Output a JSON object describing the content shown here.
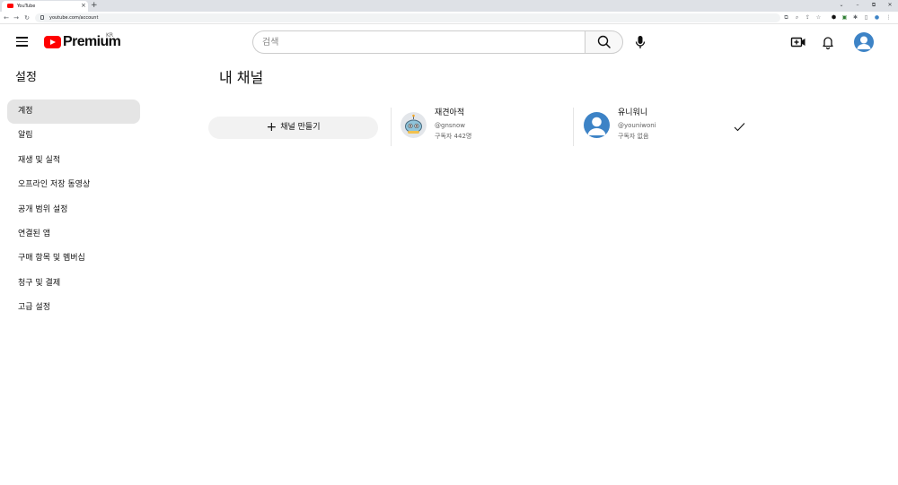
{
  "browser": {
    "tab_title": "YouTube",
    "tab_close": "×",
    "new_tab": "+",
    "url": "youtube.com/account",
    "win_min": "–",
    "win_restore": "⧉",
    "win_close": "✕",
    "win_dropdown": "⌄"
  },
  "header": {
    "logo_text": "Premium",
    "region": "KR",
    "search_placeholder": "검색"
  },
  "sidebar": {
    "title": "설정",
    "items": [
      {
        "label": "계정",
        "active": true
      },
      {
        "label": "알림"
      },
      {
        "label": "재생 및 실적"
      },
      {
        "label": "오프라인 저장 동영상"
      },
      {
        "label": "공개 범위 설정"
      },
      {
        "label": "연결된 앱"
      },
      {
        "label": "구매 항목 및 멤버십"
      },
      {
        "label": "청구 및 결제"
      },
      {
        "label": "고급 설정"
      }
    ]
  },
  "main": {
    "title": "내 채널",
    "create_label": "채널 만들기",
    "create_plus": "+",
    "channels": [
      {
        "name": "재견아적",
        "handle": "@gnsnow",
        "subscribers": "구독자 442명",
        "icon": "robot-avatar-icon"
      },
      {
        "name": "유니워니",
        "handle": "@youniwoni",
        "subscribers": "구독자 없음",
        "icon": "default-user-avatar-icon",
        "selected": true
      }
    ]
  },
  "colors": {
    "brand_red": "#ff0000",
    "active_item_bg": "#e5e5e5",
    "avatar_blue": "#3d83c6"
  }
}
